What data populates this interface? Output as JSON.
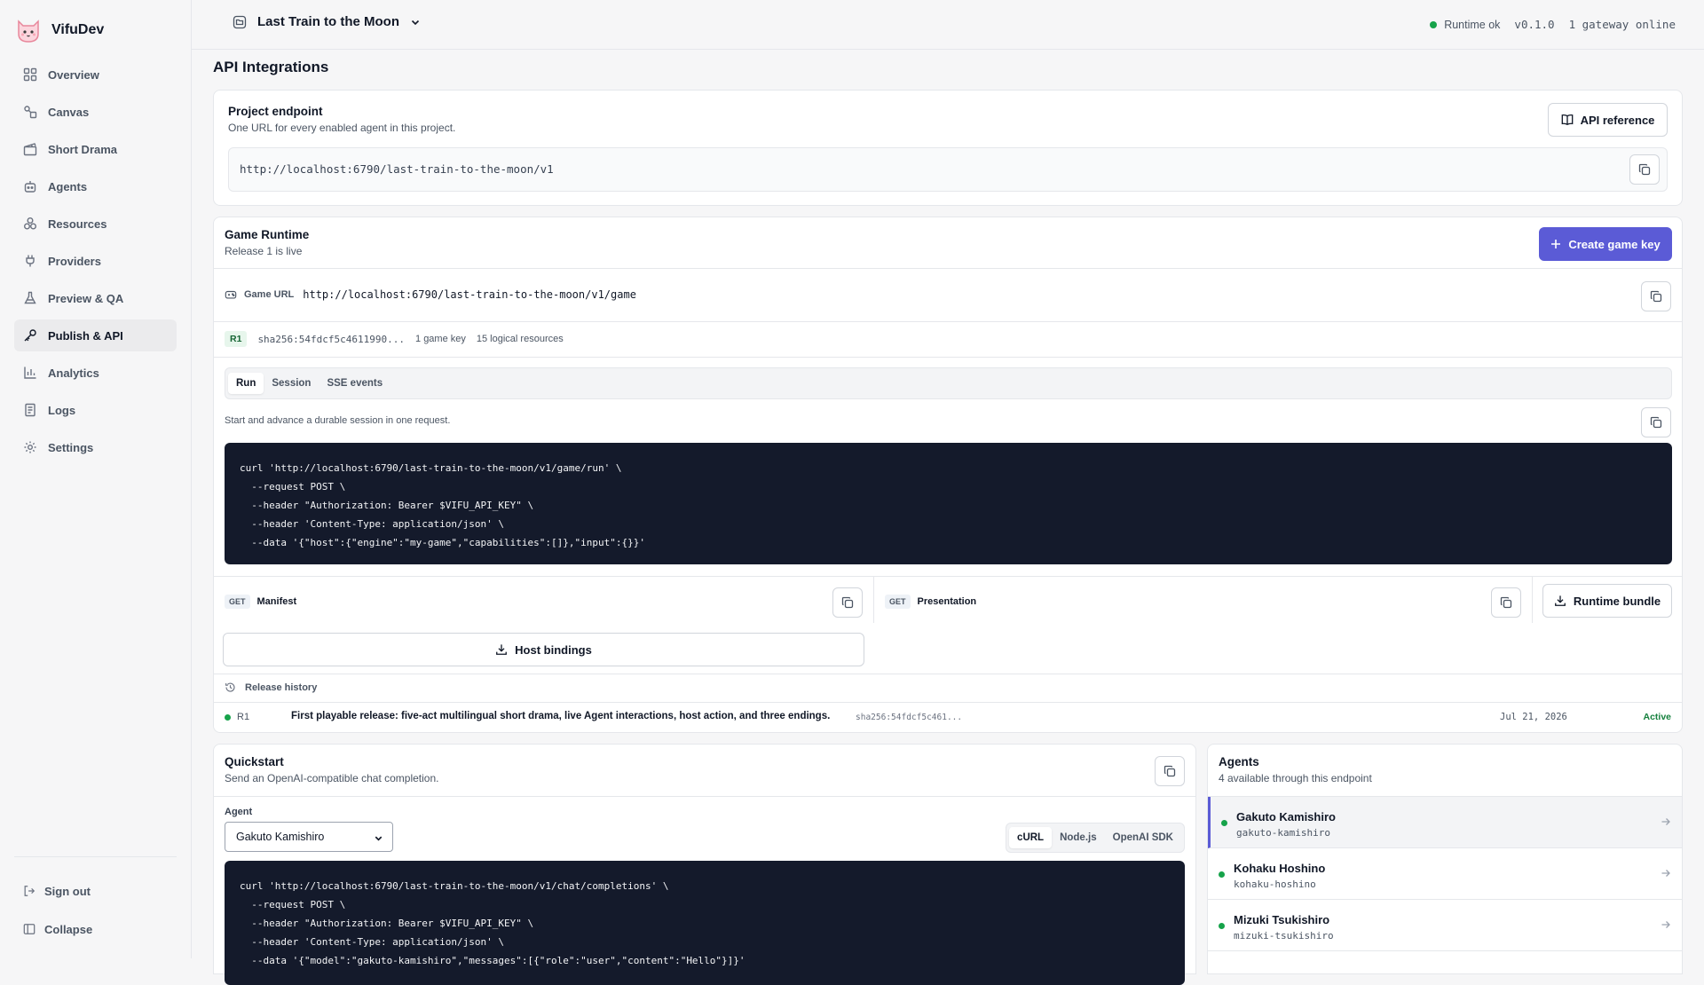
{
  "app": {
    "name": "VifuDev"
  },
  "sidebar": {
    "items": [
      {
        "label": "Overview",
        "icon": "grid-icon",
        "active": false
      },
      {
        "label": "Canvas",
        "icon": "canvas-icon",
        "active": false
      },
      {
        "label": "Short Drama",
        "icon": "clapperboard-icon",
        "active": false
      },
      {
        "label": "Agents",
        "icon": "bot-icon",
        "active": false
      },
      {
        "label": "Resources",
        "icon": "boxes-icon",
        "active": false
      },
      {
        "label": "Providers",
        "icon": "plug-icon",
        "active": false
      },
      {
        "label": "Preview & QA",
        "icon": "flask-icon",
        "active": false
      },
      {
        "label": "Publish & API",
        "icon": "key-icon",
        "active": true
      },
      {
        "label": "Analytics",
        "icon": "bar-chart-icon",
        "active": false
      },
      {
        "label": "Logs",
        "icon": "logs-icon",
        "active": false
      },
      {
        "label": "Settings",
        "icon": "gear-icon",
        "active": false
      }
    ],
    "sign_out": "Sign out",
    "collapse": "Collapse"
  },
  "topbar": {
    "project": "Last Train to the Moon",
    "runtime_status": "Runtime ok",
    "version": "v0.1.0",
    "gateway": "1 gateway online"
  },
  "page": {
    "title": "API Integrations"
  },
  "endpoint": {
    "title": "Project endpoint",
    "subtitle": "One URL for every enabled agent in this project.",
    "url": "http://localhost:6790/last-train-to-the-moon/v1",
    "api_reference": "API reference"
  },
  "runtime": {
    "title": "Game Runtime",
    "subtitle": "Release 1 is live",
    "create_key": "Create game key",
    "game_url_label": "Game URL",
    "game_url": "http://localhost:6790/last-train-to-the-moon/v1/game",
    "release_tag": "R1",
    "hash": "sha256:54fdcf5c4611990...",
    "keys": "1 game key",
    "resources": "15 logical resources",
    "tabs": [
      "Run",
      "Session",
      "SSE events"
    ],
    "description": "Start and advance a durable session in one request.",
    "code": "curl 'http://localhost:6790/last-train-to-the-moon/v1/game/run' \\\n  --request POST \\\n  --header \"Authorization: Bearer $VIFU_API_KEY\" \\\n  --header 'Content-Type: application/json' \\\n  --data '{\"host\":{\"engine\":\"my-game\",\"capabilities\":[]},\"input\":{}}'",
    "manifest_method": "GET",
    "manifest_label": "Manifest",
    "presentation_method": "GET",
    "presentation_label": "Presentation",
    "runtime_bundle": "Runtime bundle",
    "host_bindings": "Host bindings",
    "release_history": "Release history",
    "release": {
      "tag": "R1",
      "title": "First playable release: five-act multilingual short drama, live Agent interactions, host action, and three endings.",
      "hash": "sha256:54fdcf5c461...",
      "date": "Jul 21, 2026",
      "status": "Active"
    }
  },
  "quickstart": {
    "title": "Quickstart",
    "subtitle": "Send an OpenAI-compatible chat completion.",
    "agent_label": "Agent",
    "agent_selected": "Gakuto Kamishiro",
    "tabs": [
      "cURL",
      "Node.js",
      "OpenAI SDK"
    ],
    "code": "curl 'http://localhost:6790/last-train-to-the-moon/v1/chat/completions' \\\n  --request POST \\\n  --header \"Authorization: Bearer $VIFU_API_KEY\" \\\n  --header 'Content-Type: application/json' \\\n  --data '{\"model\":\"gakuto-kamishiro\",\"messages\":[{\"role\":\"user\",\"content\":\"Hello\"}]}'"
  },
  "agents": {
    "title": "Agents",
    "subtitle": "4 available through this endpoint",
    "list": [
      {
        "name": "Gakuto Kamishiro",
        "handle": "gakuto-kamishiro"
      },
      {
        "name": "Kohaku Hoshino",
        "handle": "kohaku-hoshino"
      },
      {
        "name": "Mizuki Tsukishiro",
        "handle": "mizuki-tsukishiro"
      }
    ]
  },
  "colors": {
    "accent": "#5b5bd6",
    "success": "#16a34a",
    "code_bg": "#141a2b"
  }
}
